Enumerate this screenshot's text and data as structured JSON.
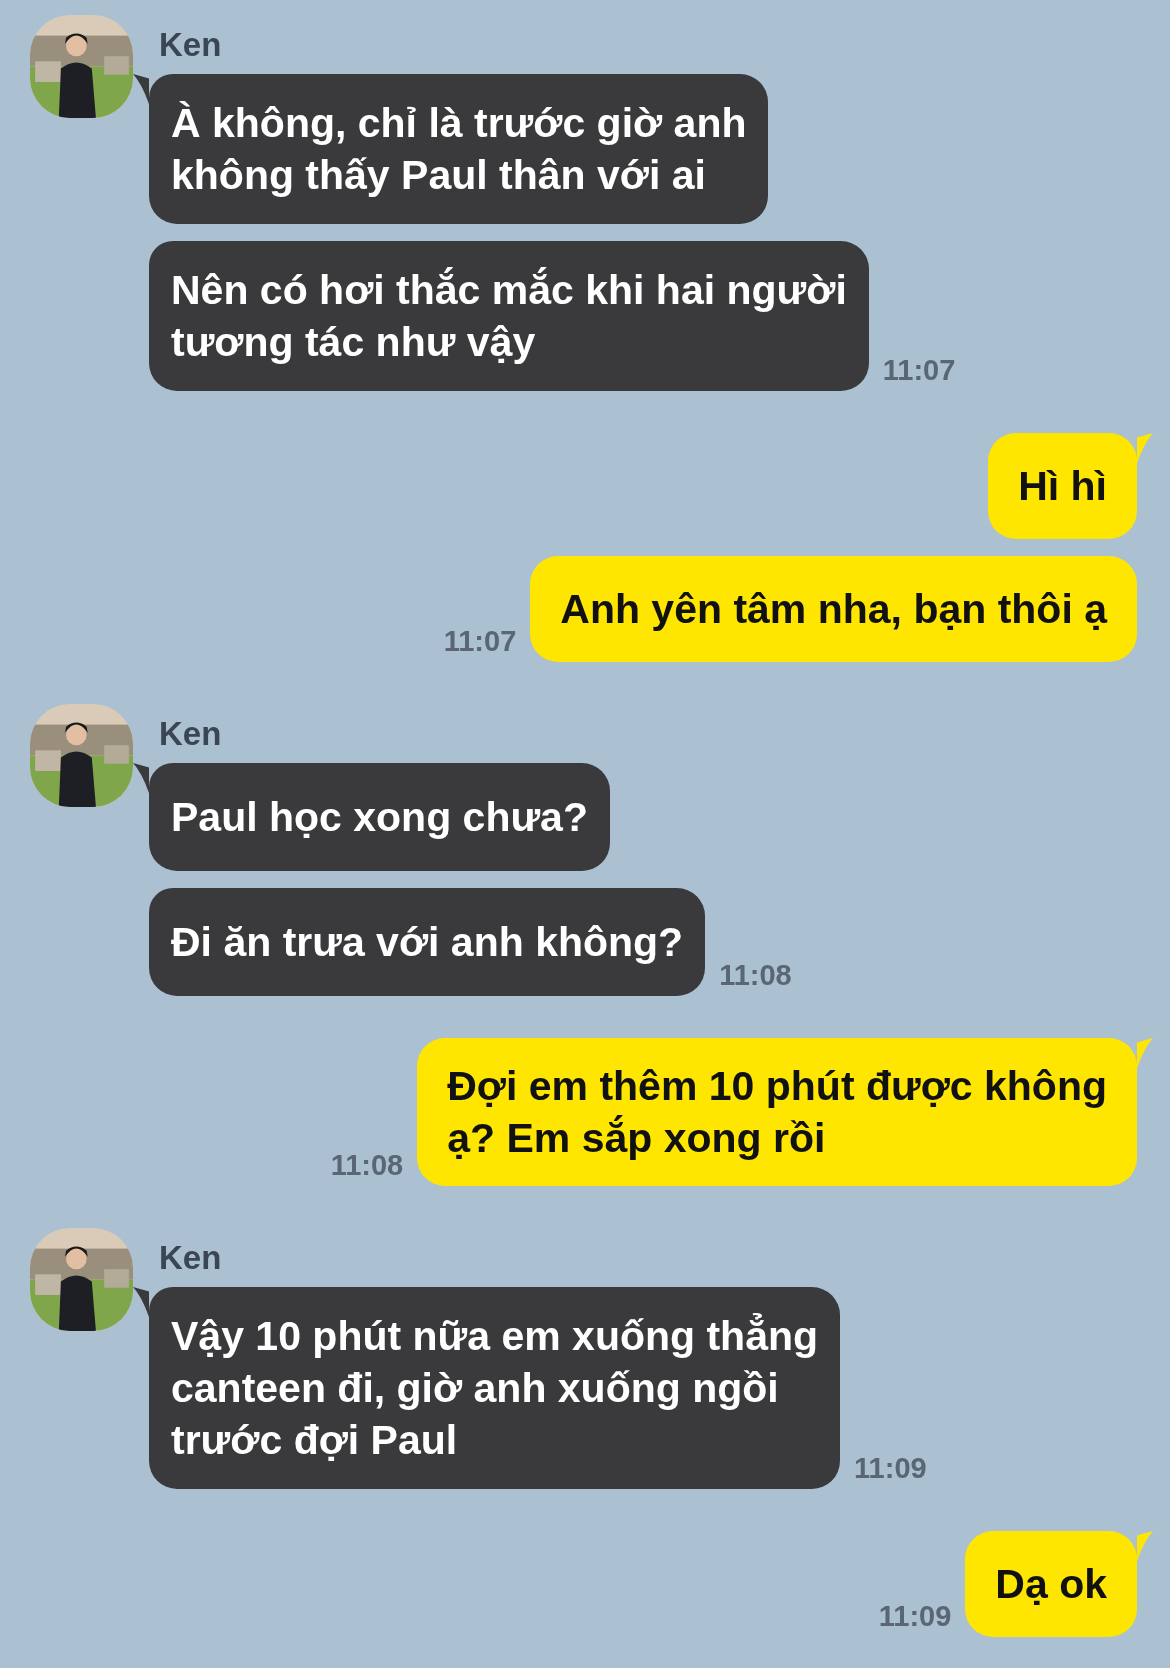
{
  "messages": [
    {
      "kind": "incoming",
      "name": "Ken",
      "avatar": {
        "kind": "picture"
      },
      "bubbles": [
        "À không, chỉ là trước giờ anh\nkhông thấy Paul thân với ai",
        "Nên có hơi thắc mắc khi hai người\ntương tác như vậy"
      ],
      "time": "11:07"
    },
    {
      "kind": "outgoing",
      "bubbles": [
        "Hì hì",
        "Anh yên tâm nha, bạn thôi ạ"
      ],
      "time": "11:07"
    },
    {
      "kind": "incoming",
      "name": "Ken",
      "avatar": {
        "kind": "picture"
      },
      "bubbles": [
        "Paul học xong chưa?",
        "Đi ăn trưa với anh không?"
      ],
      "time": "11:08"
    },
    {
      "kind": "outgoing",
      "bubbles": [
        "Đợi em thêm 10 phút được không\nạ? Em sắp xong rồi"
      ],
      "time": "11:08"
    },
    {
      "kind": "incoming",
      "name": "Ken",
      "avatar": {
        "kind": "picture"
      },
      "bubbles": [
        "Vậy 10 phút nữa em xuống thẳng\ncanteen đi, giờ anh xuống ngồi\ntrước đợi Paul"
      ],
      "time": "11:09"
    },
    {
      "kind": "outgoing",
      "bubbles": [
        "Dạ ok"
      ],
      "time": "11:09"
    }
  ]
}
